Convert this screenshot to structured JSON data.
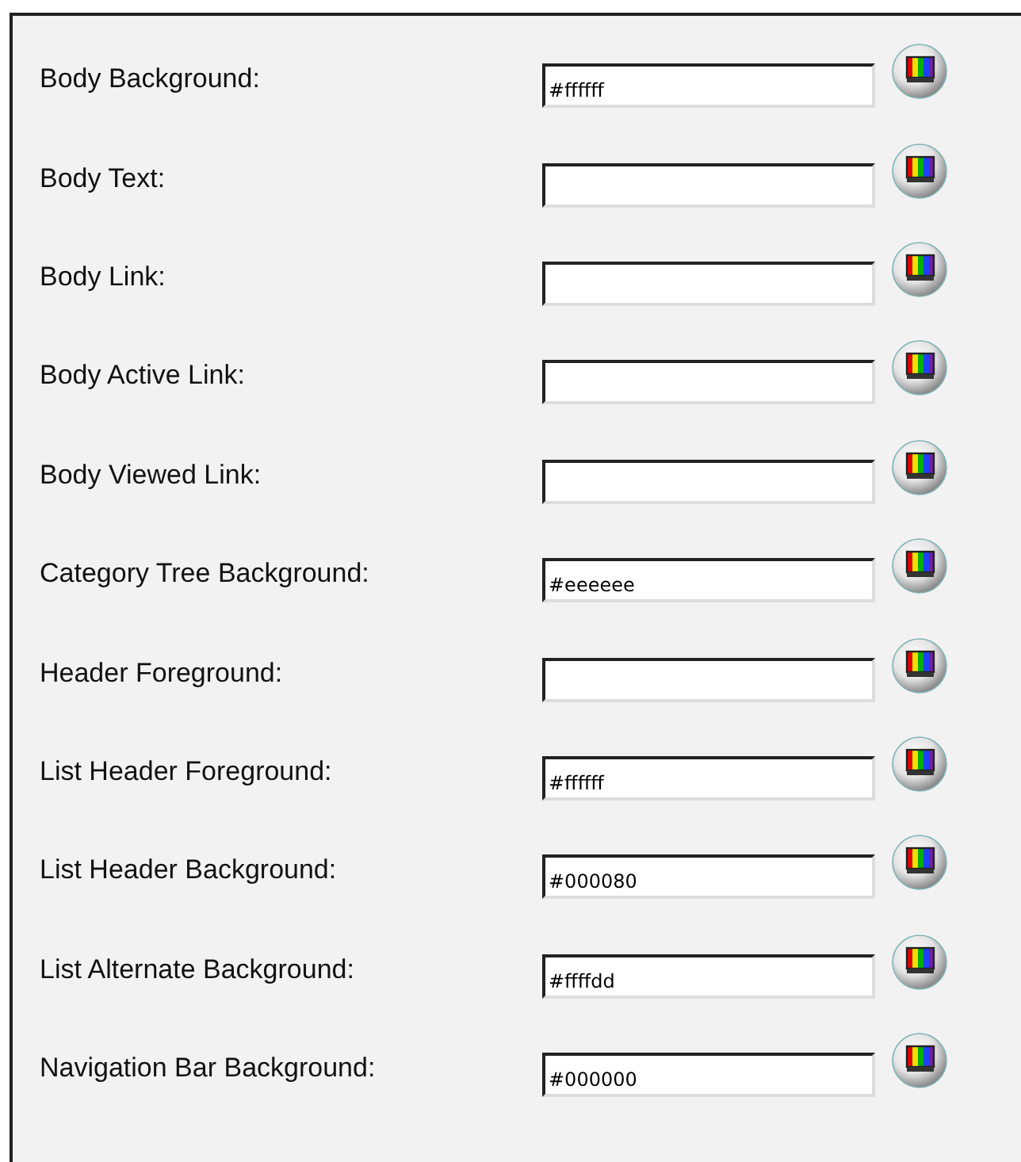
{
  "fields": [
    {
      "label": "Body Background:",
      "value": "#ffffff"
    },
    {
      "label": "Body Text:"
    },
    {
      "label": "Body Link:"
    },
    {
      "label": "Body Active Link:"
    },
    {
      "label": "Body Viewed Link:"
    },
    {
      "label": "Category Tree Background:",
      "value": "#eeeeee"
    },
    {
      "label": "Header Foreground:"
    },
    {
      "label": "List Header Foreground:",
      "value": "#ffffff"
    },
    {
      "label": "List Header Background:",
      "value": "#000080"
    },
    {
      "label": "List Alternate Background:",
      "value": "#ffffdd"
    },
    {
      "label": "Navigation Bar Background:",
      "value": "#000000"
    }
  ]
}
